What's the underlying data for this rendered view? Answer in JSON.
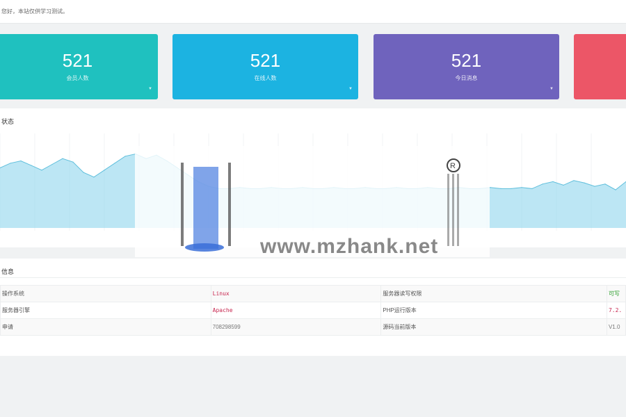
{
  "notice": {
    "text": "您好，本站仅供学习测试。"
  },
  "cards": [
    {
      "value": "521",
      "label": "会员人数",
      "color": "#1fc1bf"
    },
    {
      "value": "521",
      "label": "在线人数",
      "color": "#1cb3e1"
    },
    {
      "value": "521",
      "label": "今日消息",
      "color": "#6f63bd"
    },
    {
      "value": "",
      "label": "",
      "color": "#ec5667"
    }
  ],
  "chart_panel": {
    "title": "状态"
  },
  "chart_data": {
    "type": "area",
    "x": [
      0,
      1,
      2,
      3,
      4,
      5,
      6,
      7,
      8,
      9,
      10,
      11,
      12,
      13,
      14,
      15,
      16,
      17,
      18,
      19,
      20,
      21,
      22,
      23,
      24,
      25,
      26,
      27,
      28,
      29,
      30,
      31,
      32,
      33,
      34,
      35,
      36,
      37,
      38,
      39,
      40,
      41,
      42,
      43,
      44,
      45,
      46,
      47,
      48,
      49,
      50,
      51,
      52,
      53,
      54,
      55,
      56,
      57,
      58,
      59,
      60
    ],
    "values": [
      52,
      56,
      58,
      54,
      50,
      55,
      60,
      57,
      48,
      44,
      50,
      56,
      62,
      64,
      60,
      63,
      58,
      52,
      46,
      40,
      36,
      34,
      34,
      35,
      34,
      34,
      35,
      34,
      34,
      35,
      34,
      34,
      35,
      34,
      34,
      35,
      34,
      34,
      35,
      34,
      34,
      35,
      34,
      34,
      35,
      34,
      34,
      35,
      34,
      34,
      35,
      34,
      38,
      40,
      37,
      41,
      39,
      36,
      38,
      33,
      40
    ],
    "ylim": [
      0,
      100
    ],
    "color": "#8fd6ec",
    "grid": true
  },
  "info_panel": {
    "title": "信息",
    "rows": [
      {
        "k1": "操作系统",
        "v1": "Linux",
        "k2": "服务器读写权限",
        "v2": "可写"
      },
      {
        "k1": "服务器引擎",
        "v1": "Apache",
        "k2": "PHP运行版本",
        "v2": "7.2."
      },
      {
        "k1": "申请",
        "v1": "708298599",
        "k2": "源码当前版本",
        "v2": "V1.0"
      }
    ]
  },
  "watermark": {
    "text": "www.mzhank.net"
  }
}
